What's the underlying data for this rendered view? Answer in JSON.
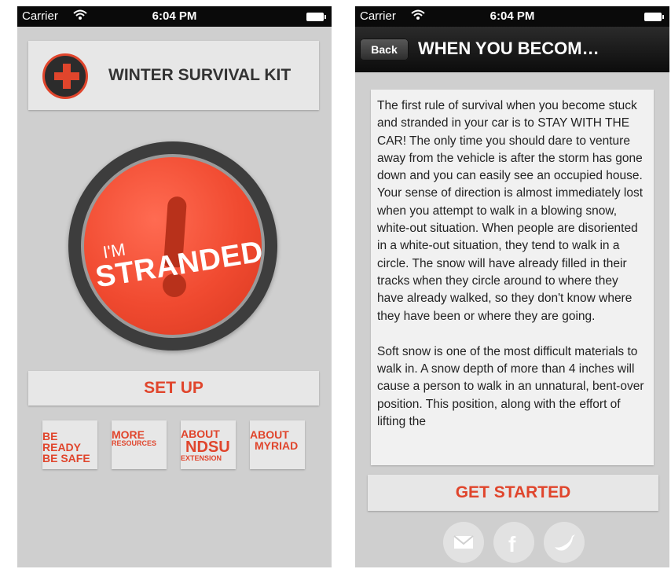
{
  "status_bar": {
    "carrier": "Carrier",
    "time": "6:04 PM"
  },
  "home": {
    "title": "WINTER SURVIVAL KIT",
    "main_button": {
      "line1": "I'M",
      "line2": "STRANDED"
    },
    "setup_label": "SET UP",
    "tiles": [
      {
        "line1": "BE READY",
        "line2": "BE SAFE"
      },
      {
        "line1": "MORE",
        "line2": "RESOURCES"
      },
      {
        "line1": "ABOUT",
        "line2": "NDSU",
        "line3": "EXTENSION"
      },
      {
        "line1": "ABOUT",
        "line2": "MYRIAD"
      }
    ]
  },
  "detail": {
    "back_label": "Back",
    "title": "WHEN YOU BECOM…",
    "paragraphs": [
      "The first rule of survival when you become stuck and stranded in your car is to STAY WITH THE CAR! The only time you should dare to venture away from the vehicle is after the storm has gone down and you can easily see an occupied house. Your sense of direction is almost immediately lost when you attempt to walk in a blowing snow, white-out situation. When people are disoriented in a white-out situation, they tend to walk in a circle. The snow will have already filled in their tracks when they circle around to where they have already walked, so they don't know where they have been or where they are going.",
      "Soft snow is one of the most difficult materials to walk in. A snow depth of more than 4 inches will cause a person to walk in an unnatural, bent-over position. This position, along with the effort of lifting the"
    ],
    "cta_label": "GET STARTED",
    "social_icons": [
      "email-icon",
      "facebook-icon",
      "twitter-icon"
    ]
  },
  "colors": {
    "accent": "#e0452c",
    "background": "#cfcfcf",
    "card": "#e7e7e7"
  }
}
